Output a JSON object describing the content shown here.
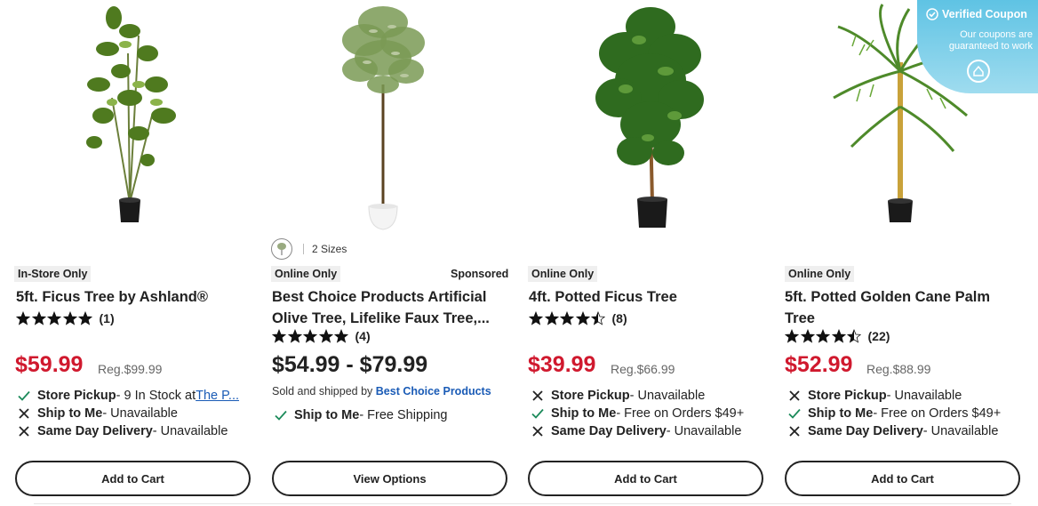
{
  "products": [
    {
      "badge": "In-Store Only",
      "title_line1": "5ft. Ficus Tree by Ashland®",
      "title_line2": "",
      "rating_count": "(1)",
      "stars": 5,
      "price": "$59.99",
      "reg_price": "Reg.$99.99",
      "fulfillment": [
        {
          "icon": "check-icon",
          "label": "Store Pickup",
          "text": " - 9 In Stock at ",
          "link": "The P..."
        },
        {
          "icon": "x-icon",
          "label": "Ship to Me",
          "text": " - Unavailable",
          "link": ""
        },
        {
          "icon": "x-icon",
          "label": "Same Day Delivery",
          "text": " - Unavailable",
          "link": ""
        }
      ],
      "button": "Add to Cart"
    },
    {
      "variant_text": "2 Sizes",
      "badge": "Online Only",
      "sponsored": "Sponsored",
      "title_line1": "Best Choice Products Artificial",
      "title_line2": "Olive Tree, Lifelike Faux Tree,...",
      "rating_count": "(4)",
      "stars": 5,
      "price_range": "$54.99 - $79.99",
      "sold_by_prefix": "Sold and shipped by ",
      "sold_by": "Best Choice Products",
      "fulfillment": [
        {
          "icon": "check-icon",
          "label": "Ship to Me",
          "text": " -  Free Shipping",
          "link": ""
        }
      ],
      "button": "View Options"
    },
    {
      "badge": "Online Only",
      "title_line1": "4ft. Potted Ficus Tree",
      "title_line2": "",
      "rating_count": "(8)",
      "stars": 4.5,
      "price": "$39.99",
      "reg_price": "Reg.$66.99",
      "fulfillment": [
        {
          "icon": "x-icon",
          "label": "Store Pickup",
          "text": " - Unavailable",
          "link": ""
        },
        {
          "icon": "check-icon",
          "label": "Ship to Me",
          "text": " -  Free on Orders $49+",
          "link": ""
        },
        {
          "icon": "x-icon",
          "label": "Same Day Delivery",
          "text": " - Unavailable",
          "link": ""
        }
      ],
      "button": "Add to Cart"
    },
    {
      "badge": "Online Only",
      "title_line1": "5ft. Potted Golden Cane Palm",
      "title_line2": "Tree",
      "rating_count": "(22)",
      "stars": 4.5,
      "price": "$52.99",
      "reg_price": "Reg.$88.99",
      "fulfillment": [
        {
          "icon": "x-icon",
          "label": "Store Pickup",
          "text": " - Unavailable",
          "link": ""
        },
        {
          "icon": "check-icon",
          "label": "Ship to Me",
          "text": " -  Free on Orders $49+",
          "link": ""
        },
        {
          "icon": "x-icon",
          "label": "Same Day Delivery",
          "text": " - Unavailable",
          "link": ""
        }
      ],
      "button": "Add to Cart"
    }
  ],
  "coupon": {
    "title": "Verified Coupon",
    "subtitle": "Our coupons are guaranteed to work"
  },
  "colors": {
    "sale_price": "#d0192e",
    "link": "#1a5bb6",
    "check": "#1b8a5a",
    "coupon_bg": "#5fc3e4"
  }
}
